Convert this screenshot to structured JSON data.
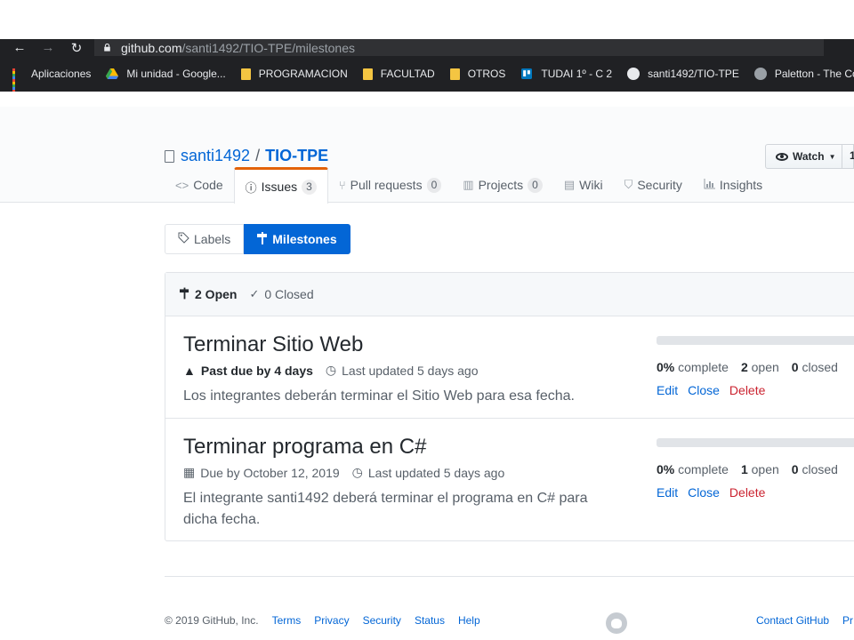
{
  "browser": {
    "url_host": "github.com",
    "url_path": "/santi1492/TIO-TPE/milestones",
    "bookmarks": [
      {
        "label": "Aplicaciones",
        "icon": "apps-grid-icon"
      },
      {
        "label": "Mi unidad - Google...",
        "icon": "google-drive-icon"
      },
      {
        "label": "PROGRAMACION",
        "icon": "folder-icon"
      },
      {
        "label": "FACULTAD",
        "icon": "folder-icon"
      },
      {
        "label": "OTROS",
        "icon": "folder-icon"
      },
      {
        "label": "TUDAI 1º - C 2",
        "icon": "trello-icon"
      },
      {
        "label": "santi1492/TIO-TPE",
        "icon": "github-icon"
      },
      {
        "label": "Paletton - The Colo",
        "icon": "paletton-icon"
      }
    ]
  },
  "repo": {
    "owner": "santi1492",
    "separator": "/",
    "name": "TIO-TPE",
    "watch_label": "Watch",
    "watch_count": "1"
  },
  "tabs": [
    {
      "label": "Code",
      "icon": "<>",
      "count": ""
    },
    {
      "label": "Issues",
      "icon": "ⓘ",
      "count": "3"
    },
    {
      "label": "Pull requests",
      "icon": "⑂",
      "count": "0"
    },
    {
      "label": "Projects",
      "icon": "▥",
      "count": "0"
    },
    {
      "label": "Wiki",
      "icon": "▤",
      "count": ""
    },
    {
      "label": "Security",
      "icon": "⛉",
      "count": ""
    },
    {
      "label": "Insights",
      "icon": "📊",
      "count": ""
    }
  ],
  "subnav": {
    "labels": "Labels",
    "milestones": "Milestones"
  },
  "filter": {
    "open": "2 Open",
    "closed": "0 Closed"
  },
  "milestones": [
    {
      "title": "Terminar Sitio Web",
      "due": "Past due by 4 days",
      "updated": "Last updated 5 days ago",
      "description": "Los integrantes deberán terminar el Sitio Web para esa fecha.",
      "progress": 0,
      "percent": "0%",
      "complete_label": "complete",
      "open_count": "2",
      "open_label": "open",
      "closed_count": "0",
      "closed_label": "closed"
    },
    {
      "title": "Terminar programa en C#",
      "due": "Due by October 12, 2019",
      "updated": "Last updated 5 days ago",
      "description": "El integrante santi1492 deberá terminar el programa en C# para dicha fecha.",
      "progress": 0,
      "percent": "0%",
      "complete_label": "complete",
      "open_count": "1",
      "open_label": "open",
      "closed_count": "0",
      "closed_label": "closed"
    }
  ],
  "actions": {
    "edit": "Edit",
    "close": "Close",
    "delete": "Delete"
  },
  "footer": {
    "copyright": "© 2019 GitHub, Inc.",
    "links": [
      "Terms",
      "Privacy",
      "Security",
      "Status",
      "Help"
    ],
    "right_links": [
      "Contact GitHub",
      "Pr"
    ]
  },
  "colors": {
    "link": "#0366d6",
    "accent_tab": "#e36209",
    "danger": "#cb2431",
    "selected_button": "#0366d6"
  }
}
